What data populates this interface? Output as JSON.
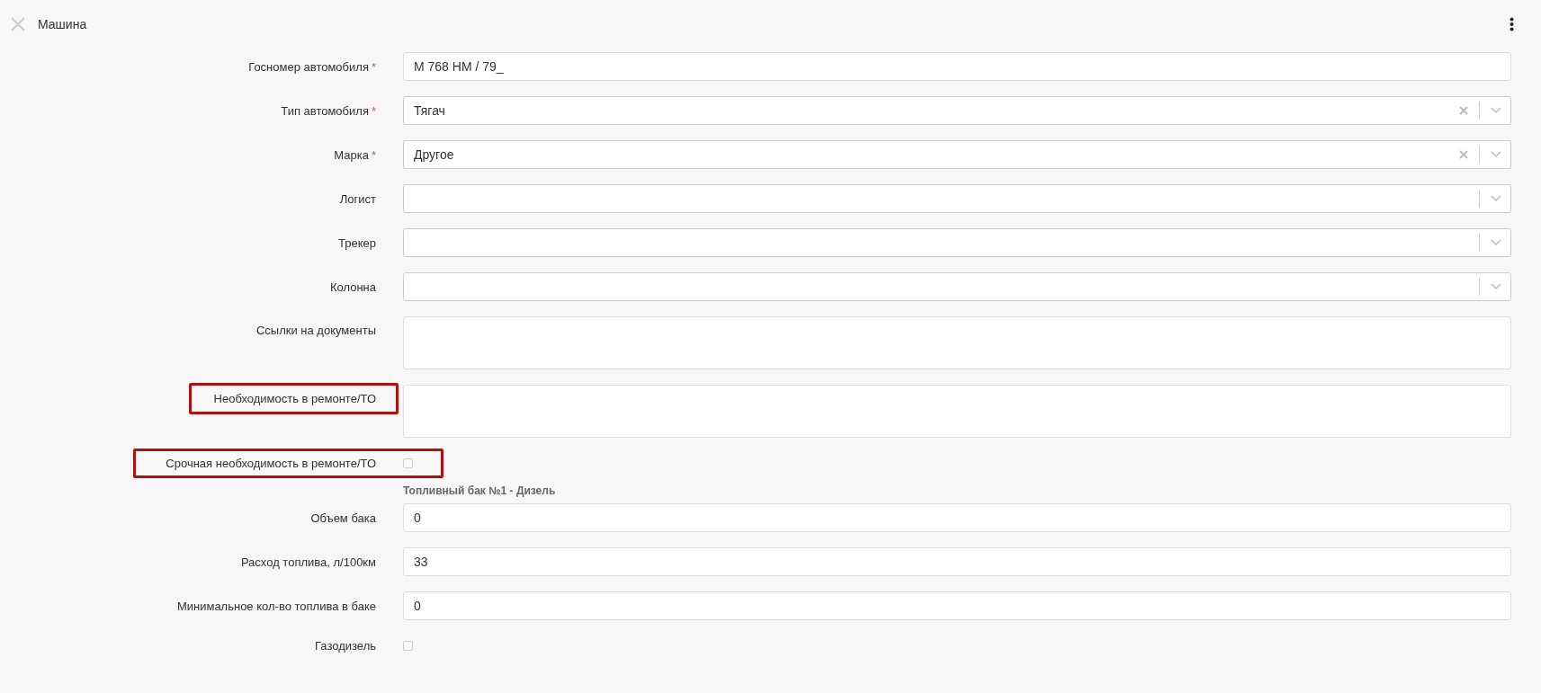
{
  "header": {
    "title": "Машина"
  },
  "fields": [
    {
      "kind": "text",
      "label": "Госномер автомобиля",
      "required_mark": "*",
      "highlighted": false,
      "value": "M 768 HM / 79_"
    },
    {
      "kind": "select",
      "label": "Тип автомобиля",
      "required_mark": "*",
      "highlighted": false,
      "value": "Тягач"
    },
    {
      "kind": "select",
      "label": "Марка",
      "required_mark": "*",
      "highlighted": false,
      "value": "Другое"
    },
    {
      "kind": "select",
      "label": "Логист",
      "highlighted": false
    },
    {
      "kind": "select",
      "label": "Трекер",
      "highlighted": false
    },
    {
      "kind": "select",
      "label": "Колонна",
      "highlighted": false
    },
    {
      "kind": "textarea",
      "label": "Ссылки на документы",
      "highlighted": false
    },
    {
      "kind": "textarea",
      "label": "Необходимость в ремонте/ТО",
      "highlighted": true
    },
    {
      "kind": "checkbox",
      "label": "Срочная необходимость в ремонте/ТО",
      "highlighted": true,
      "checked": false
    },
    {
      "kind": "section",
      "title": "Топливный бак №1 - Дизель"
    },
    {
      "kind": "text",
      "label": "Объем бака",
      "highlighted": false,
      "value": "0"
    },
    {
      "kind": "text",
      "label": "Расход топлива, л/100км",
      "highlighted": false,
      "value": "33"
    },
    {
      "kind": "text",
      "label": "Минимальное кол-во топлива в баке",
      "highlighted": false,
      "value": "0"
    },
    {
      "kind": "checkbox",
      "label": "Газодизель",
      "highlighted": false,
      "checked": false
    }
  ]
}
